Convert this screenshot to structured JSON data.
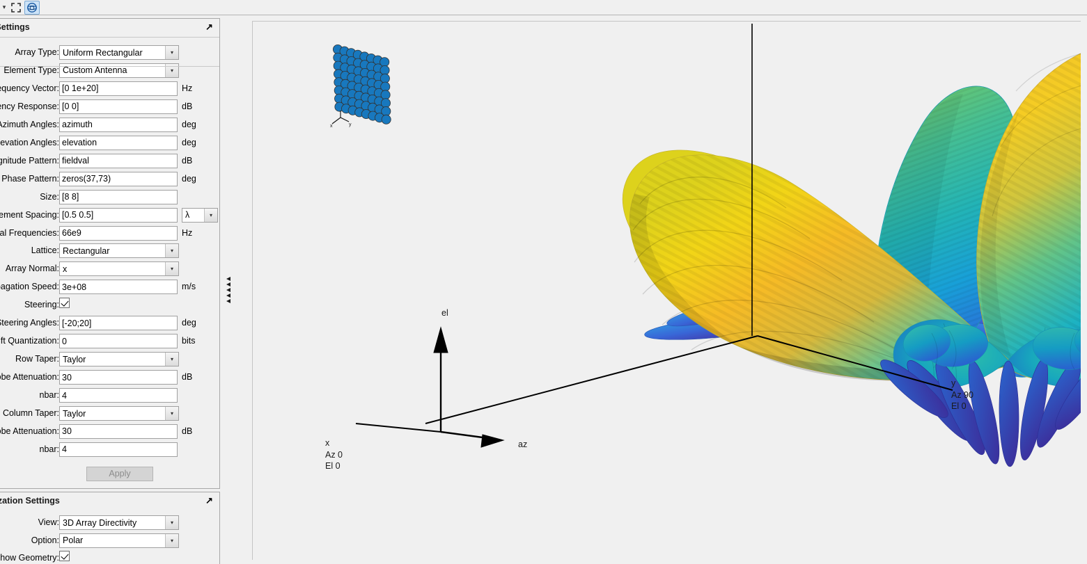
{
  "toolbar": {
    "items": [
      {
        "name": "maximize-icon",
        "label": "Maximize"
      },
      {
        "name": "rotate-3d-icon",
        "label": "Rotate 3D",
        "selected": true
      }
    ]
  },
  "array_panel": {
    "title": "y Settings",
    "full_title": "Array Settings",
    "undock_glyph": "↗",
    "fields": [
      {
        "label": "Array Type:",
        "type": "select",
        "value": "Uniform Rectangular",
        "unit": "",
        "name": "array-type"
      },
      {
        "label": "Element Type:",
        "type": "select",
        "value": "Custom Antenna",
        "unit": "",
        "name": "element-type"
      },
      {
        "label": "Frequency Vector:",
        "type": "text",
        "value": "[0 1e+20]",
        "unit": "Hz",
        "name": "frequency-vector"
      },
      {
        "label": "quency Response:",
        "type": "text",
        "value": "[0 0]",
        "unit": "dB",
        "name": "frequency-response"
      },
      {
        "label": "Azimuth Angles:",
        "type": "text",
        "value": "azimuth",
        "unit": "deg",
        "name": "azimuth-angles"
      },
      {
        "label": "Elevation Angles:",
        "type": "text",
        "value": "elevation",
        "unit": "deg",
        "name": "elevation-angles"
      },
      {
        "label": "Magnitude Pattern:",
        "type": "text",
        "value": "fieldval",
        "unit": "dB",
        "name": "magnitude-pattern"
      },
      {
        "label": "Phase Pattern:",
        "type": "text",
        "value": "zeros(37,73)",
        "unit": "deg",
        "name": "phase-pattern"
      },
      {
        "label": "Size:",
        "type": "text",
        "value": "[8 8]",
        "unit": "",
        "name": "size"
      },
      {
        "label": "Element Spacing:",
        "type": "text",
        "value": "[0.5 0.5]",
        "unit": "",
        "name": "element-spacing",
        "extra_select": "λ"
      },
      {
        "label": "Signal Frequencies:",
        "type": "text",
        "value": "66e9",
        "unit": "Hz",
        "name": "signal-frequencies"
      },
      {
        "label": "Lattice:",
        "type": "select",
        "value": "Rectangular",
        "unit": "",
        "name": "lattice"
      },
      {
        "label": "Array Normal:",
        "type": "select",
        "value": "x",
        "unit": "",
        "name": "array-normal"
      },
      {
        "label": "Propagation Speed:",
        "type": "text",
        "value": "3e+08",
        "unit": "m/s",
        "name": "propagation-speed"
      },
      {
        "label": "Steering:",
        "type": "check",
        "value": "checked",
        "unit": "",
        "name": "steering"
      },
      {
        "label": "Steering Angles:",
        "type": "text",
        "value": "[-20;20]",
        "unit": "deg",
        "name": "steering-angles"
      },
      {
        "label": "Shift Quantization:",
        "type": "text",
        "value": "0",
        "unit": "bits",
        "name": "shift-quantization"
      },
      {
        "label": "Row Taper:",
        "type": "select",
        "value": "Taylor",
        "unit": "",
        "name": "row-taper"
      },
      {
        "label": "delobe Attenuation:",
        "type": "text",
        "value": "30",
        "unit": "dB",
        "name": "row-sidelobe-attenuation"
      },
      {
        "label": "nbar:",
        "type": "text",
        "value": "4",
        "unit": "",
        "name": "row-nbar"
      },
      {
        "label": "Column Taper:",
        "type": "select",
        "value": "Taylor",
        "unit": "",
        "name": "column-taper"
      },
      {
        "label": "delobe Attenuation:",
        "type": "text",
        "value": "30",
        "unit": "dB",
        "name": "column-sidelobe-attenuation"
      },
      {
        "label": "nbar:",
        "type": "text",
        "value": "4",
        "unit": "",
        "name": "column-nbar"
      }
    ],
    "apply_label": "Apply"
  },
  "vis_panel": {
    "title": "alization Settings",
    "full_title": "Visualization Settings",
    "undock_glyph": "↗",
    "fields": [
      {
        "label": "View:",
        "type": "select",
        "value": "3D Array Directivity",
        "name": "view"
      },
      {
        "label": "Option:",
        "type": "select",
        "value": "Polar",
        "name": "option"
      },
      {
        "label": "Show Geometry:",
        "type": "check",
        "value": "checked",
        "name": "show-geometry"
      }
    ]
  },
  "splitter": {
    "glyph_count": 5
  },
  "plot": {
    "axis_labels": {
      "el": "el",
      "az": "az",
      "x_block": "x\nAz 0\nEl 0",
      "y_block": "y\nAz 90\nEl 0"
    },
    "geometry_inset": {
      "rows": 8,
      "cols": 8,
      "element_color": "#1878be",
      "axis_x": "x",
      "axis_y": "y"
    }
  },
  "chart_data": {
    "type": "surface3d",
    "title": "3D Array Directivity",
    "plot_option": "Polar",
    "colormap": "parula",
    "colormap_stops": [
      "#352a87",
      "#1f4bbf",
      "#1077d6",
      "#059fd3",
      "#1fb8b0",
      "#6bc77d",
      "#b5c34f",
      "#f0bd2d",
      "#f9fb0e"
    ],
    "array": {
      "type": "Uniform Rectangular",
      "size": [
        8,
        8
      ],
      "spacing_lambda": [
        0.5,
        0.5
      ],
      "lattice": "Rectangular",
      "normal": "x"
    },
    "signal_frequency_hz": 66000000000.0,
    "propagation_speed_mps": 300000000.0,
    "steering_angles_deg": {
      "azimuth": -20,
      "elevation": 20
    },
    "taper": {
      "row": "Taylor",
      "row_sidelobe_db": 30,
      "row_nbar": 4,
      "column": "Taylor",
      "column_sidelobe_db": 30,
      "column_nbar": 4
    },
    "axes": {
      "az_reference_deg": 0,
      "el_reference_deg": 0,
      "y_az_deg": 90,
      "y_el_deg": 0
    },
    "lobes": [
      {
        "name": "left-main-lobe",
        "peak_color": "#e8d21a",
        "az_deg": -60,
        "el_deg": 5,
        "relative_level": 1.0
      },
      {
        "name": "center-lobe",
        "peak_color": "#3fbf94",
        "az_deg": -5,
        "el_deg": 40,
        "relative_level": 0.78
      },
      {
        "name": "right-main-lobe",
        "peak_color": "#f0bd2d",
        "az_deg": 45,
        "el_deg": 30,
        "relative_level": 0.96
      },
      {
        "name": "inner-right-lobe",
        "peak_color": "#35bcc0",
        "az_deg": 20,
        "el_deg": 20,
        "relative_level": 0.62
      },
      {
        "name": "sidelobe-fan",
        "peak_color": "#3b42c4",
        "az_deg": 0,
        "el_deg": -30,
        "relative_level": 0.22
      }
    ]
  }
}
